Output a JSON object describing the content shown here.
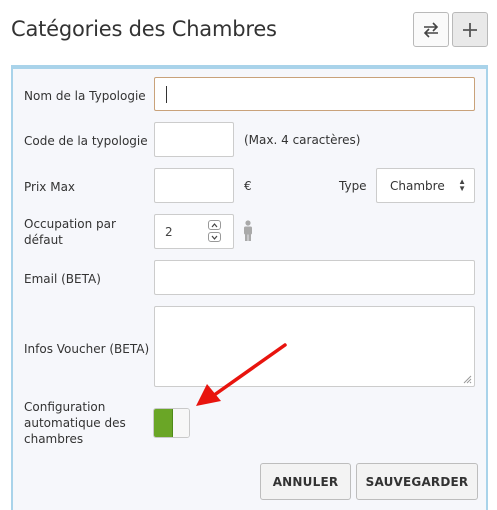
{
  "header": {
    "title": "Catégories des Chambres",
    "swap_button_icon": "swap-arrows-icon",
    "add_button_icon": "plus-icon"
  },
  "form": {
    "typology_name": {
      "label": "Nom de la Typologie",
      "value": ""
    },
    "typology_code": {
      "label": "Code de la typologie",
      "value": "",
      "hint": "(Max. 4 caractères)"
    },
    "max_price": {
      "label": "Prix Max",
      "value": "",
      "currency": "€"
    },
    "type": {
      "label": "Type",
      "selected": "Chambre"
    },
    "default_occupancy": {
      "label": "Occupation par défaut",
      "value": "2",
      "icon": "person-icon"
    },
    "email": {
      "label": "Email (BETA)",
      "value": ""
    },
    "voucher_info": {
      "label": "Infos Voucher (BETA)",
      "value": ""
    },
    "auto_config": {
      "label": "Configuration automatique des chambres",
      "enabled": true,
      "on_color": "#6aa626"
    }
  },
  "actions": {
    "cancel_label": "ANNULER",
    "save_label": "SAUVEGARDER"
  },
  "annotation": {
    "arrow_color": "#e8140e"
  },
  "colors": {
    "panel_border": "#a9d3ea",
    "panel_bg": "#f6f7fb",
    "focus_border": "#c9a27a"
  }
}
